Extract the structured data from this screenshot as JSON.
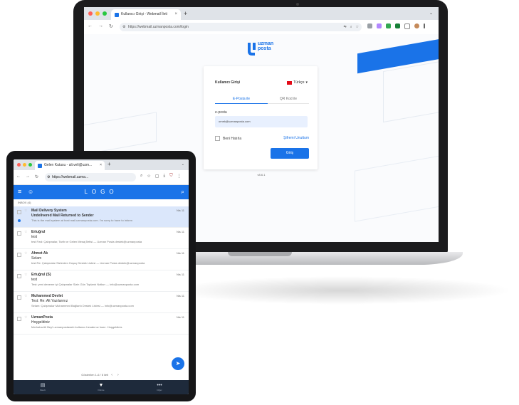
{
  "laptop": {
    "tab_title": "Kullanıcı Girişi - Webmail  İleti",
    "url": "https://webmail.uzmanposta.com/login",
    "brand_line1": "uzman",
    "brand_line2": "posta",
    "login": {
      "title": "Kullanıcı Girişi",
      "language": "Türkçe",
      "tab_email": "E-Posta ile",
      "tab_qr": "QR Kod ile",
      "email_label": "e-posta",
      "email_value": "ornek@uzmanposta.com",
      "remember_label": "Beni Hatırla",
      "forgot_label": "Şifremi Unuttum",
      "submit_label": "Giriş"
    },
    "footer": "v8.6.1"
  },
  "tablet": {
    "tab_title": "Gelen Kutusu - ali.veli@uzm...",
    "url": "https://webmail.uzma...",
    "logo": "LOGO",
    "folder": "INBOX (4)",
    "emails": [
      {
        "from": "Mail Delivery System",
        "subject": "Undelivered Mail Returned to Sender",
        "snippet": "This is the mail system at host mail.uzmanposta.com. I'm sorry to have to inform",
        "date": "Nis 11",
        "selected": true
      },
      {
        "from": "Ertuğrul",
        "subject": "test",
        "snippet": "test Fwd: Çalışmalar, Tarih ve Gelen Mesaj İletisi — Uzman Posta destek@uzmanposta",
        "date": "Nis 11",
        "selected": false
      },
      {
        "from": "Ahmet Ak",
        "subject": "Selam",
        "snippet": "test Re: Çalışmalar Sizlerden Hoşuç Destek Listesi — Uzman Posta destek@uzmanposta",
        "date": "Nis 11",
        "selected": false
      },
      {
        "from": "Ertuğrul (S)",
        "subject": "test",
        "snippet": "Test: yeni deneme içi Çalışmalar Sizin Gün Toplantı Notları — info@uzmanposta.com",
        "date": "Nis 11",
        "selected": false
      },
      {
        "from": "Muhammed Devlet",
        "subject": "Test: Re: Alt Yazılarınız",
        "snippet": "Selam: Çalışmalar Muhammed Bağlantı Destek Listesi — info@uzmanposta.com",
        "date": "Nis 11",
        "selected": false
      },
      {
        "from": "UzmanPosta",
        "subject": "Hoşgeldiniz",
        "snippet": "Merhaba Ali Bey! uzmanpostaweb kullanıcı hesabınız hazır. Hoşgeldiniz.",
        "date": "Nis 11",
        "selected": false
      }
    ],
    "pager": "Gösterilen 1-6 / 6 ileti",
    "nav": [
      {
        "label": "Klasör",
        "glyph": "▤"
      },
      {
        "label": "Filtrele",
        "glyph": "▼"
      },
      {
        "label": "Diğer",
        "glyph": "•••"
      }
    ]
  }
}
